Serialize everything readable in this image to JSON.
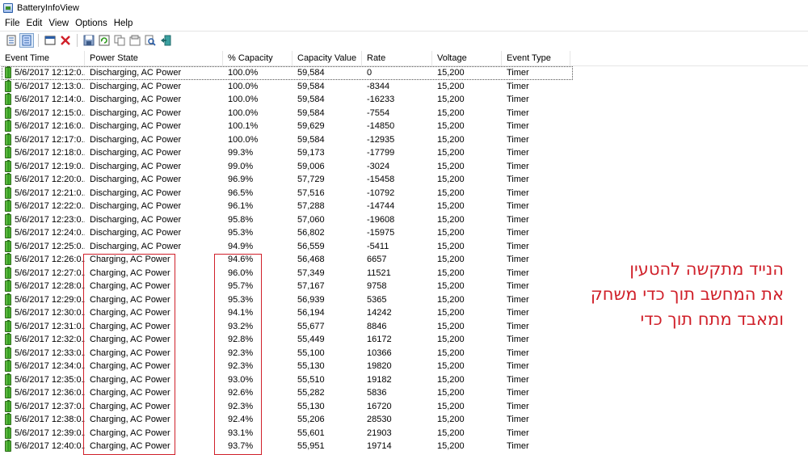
{
  "window": {
    "title": "BatteryInfoView"
  },
  "menu": [
    "File",
    "Edit",
    "View",
    "Options",
    "Help"
  ],
  "toolbar": [
    {
      "name": "html-report-all-icon"
    },
    {
      "name": "html-report-selected-icon",
      "active": true
    },
    {
      "name": "sep"
    },
    {
      "name": "battery-information-mode-icon"
    },
    {
      "name": "delete-icon"
    },
    {
      "name": "sep"
    },
    {
      "name": "save-icon"
    },
    {
      "name": "refresh-icon"
    },
    {
      "name": "copy-icon"
    },
    {
      "name": "properties-icon"
    },
    {
      "name": "find-icon"
    },
    {
      "name": "exit-icon"
    }
  ],
  "columns": [
    "Event Time",
    "Power State",
    "% Capacity",
    "Capacity Value",
    "Rate",
    "Voltage",
    "Event Type"
  ],
  "rows": [
    [
      "5/6/2017 12:12:0...",
      "Discharging, AC Power",
      "100.0%",
      "59,584",
      "0",
      "15,200",
      "Timer"
    ],
    [
      "5/6/2017 12:13:0...",
      "Discharging, AC Power",
      "100.0%",
      "59,584",
      "-8344",
      "15,200",
      "Timer"
    ],
    [
      "5/6/2017 12:14:0...",
      "Discharging, AC Power",
      "100.0%",
      "59,584",
      "-16233",
      "15,200",
      "Timer"
    ],
    [
      "5/6/2017 12:15:0...",
      "Discharging, AC Power",
      "100.0%",
      "59,584",
      "-7554",
      "15,200",
      "Timer"
    ],
    [
      "5/6/2017 12:16:0...",
      "Discharging, AC Power",
      "100.1%",
      "59,629",
      "-14850",
      "15,200",
      "Timer"
    ],
    [
      "5/6/2017 12:17:0...",
      "Discharging, AC Power",
      "100.0%",
      "59,584",
      "-12935",
      "15,200",
      "Timer"
    ],
    [
      "5/6/2017 12:18:0...",
      "Discharging, AC Power",
      "99.3%",
      "59,173",
      "-17799",
      "15,200",
      "Timer"
    ],
    [
      "5/6/2017 12:19:0...",
      "Discharging, AC Power",
      "99.0%",
      "59,006",
      "-3024",
      "15,200",
      "Timer"
    ],
    [
      "5/6/2017 12:20:0...",
      "Discharging, AC Power",
      "96.9%",
      "57,729",
      "-15458",
      "15,200",
      "Timer"
    ],
    [
      "5/6/2017 12:21:0...",
      "Discharging, AC Power",
      "96.5%",
      "57,516",
      "-10792",
      "15,200",
      "Timer"
    ],
    [
      "5/6/2017 12:22:0...",
      "Discharging, AC Power",
      "96.1%",
      "57,288",
      "-14744",
      "15,200",
      "Timer"
    ],
    [
      "5/6/2017 12:23:0...",
      "Discharging, AC Power",
      "95.8%",
      "57,060",
      "-19608",
      "15,200",
      "Timer"
    ],
    [
      "5/6/2017 12:24:0...",
      "Discharging, AC Power",
      "95.3%",
      "56,802",
      "-15975",
      "15,200",
      "Timer"
    ],
    [
      "5/6/2017 12:25:0...",
      "Discharging, AC Power",
      "94.9%",
      "56,559",
      "-5411",
      "15,200",
      "Timer"
    ],
    [
      "5/6/2017 12:26:0...",
      "Charging, AC Power",
      "94.6%",
      "56,468",
      "6657",
      "15,200",
      "Timer"
    ],
    [
      "5/6/2017 12:27:0...",
      "Charging, AC Power",
      "96.0%",
      "57,349",
      "11521",
      "15,200",
      "Timer"
    ],
    [
      "5/6/2017 12:28:0...",
      "Charging, AC Power",
      "95.7%",
      "57,167",
      "9758",
      "15,200",
      "Timer"
    ],
    [
      "5/6/2017 12:29:0...",
      "Charging, AC Power",
      "95.3%",
      "56,939",
      "5365",
      "15,200",
      "Timer"
    ],
    [
      "5/6/2017 12:30:0...",
      "Charging, AC Power",
      "94.1%",
      "56,194",
      "14242",
      "15,200",
      "Timer"
    ],
    [
      "5/6/2017 12:31:0...",
      "Charging, AC Power",
      "93.2%",
      "55,677",
      "8846",
      "15,200",
      "Timer"
    ],
    [
      "5/6/2017 12:32:0...",
      "Charging, AC Power",
      "92.8%",
      "55,449",
      "16172",
      "15,200",
      "Timer"
    ],
    [
      "5/6/2017 12:33:0...",
      "Charging, AC Power",
      "92.3%",
      "55,100",
      "10366",
      "15,200",
      "Timer"
    ],
    [
      "5/6/2017 12:34:0...",
      "Charging, AC Power",
      "92.3%",
      "55,130",
      "19820",
      "15,200",
      "Timer"
    ],
    [
      "5/6/2017 12:35:0...",
      "Charging, AC Power",
      "93.0%",
      "55,510",
      "19182",
      "15,200",
      "Timer"
    ],
    [
      "5/6/2017 12:36:0...",
      "Charging, AC Power",
      "92.6%",
      "55,282",
      "5836",
      "15,200",
      "Timer"
    ],
    [
      "5/6/2017 12:37:0...",
      "Charging, AC Power",
      "92.3%",
      "55,130",
      "16720",
      "15,200",
      "Timer"
    ],
    [
      "5/6/2017 12:38:0...",
      "Charging, AC Power",
      "92.4%",
      "55,206",
      "28530",
      "15,200",
      "Timer"
    ],
    [
      "5/6/2017 12:39:0...",
      "Charging, AC Power",
      "93.1%",
      "55,601",
      "21903",
      "15,200",
      "Timer"
    ],
    [
      "5/6/2017 12:40:0...",
      "Charging, AC Power",
      "93.7%",
      "55,951",
      "19714",
      "15,200",
      "Timer"
    ]
  ],
  "annotation": {
    "lines": [
      "הנייד מתקשה להטעין",
      "את המחשב תוך כדי משחק",
      "ומאבד מתח תוך כדי"
    ],
    "color": "#d0202a"
  },
  "colors": {
    "highlight": "#d0202a",
    "battery": "#2f9a1e"
  }
}
